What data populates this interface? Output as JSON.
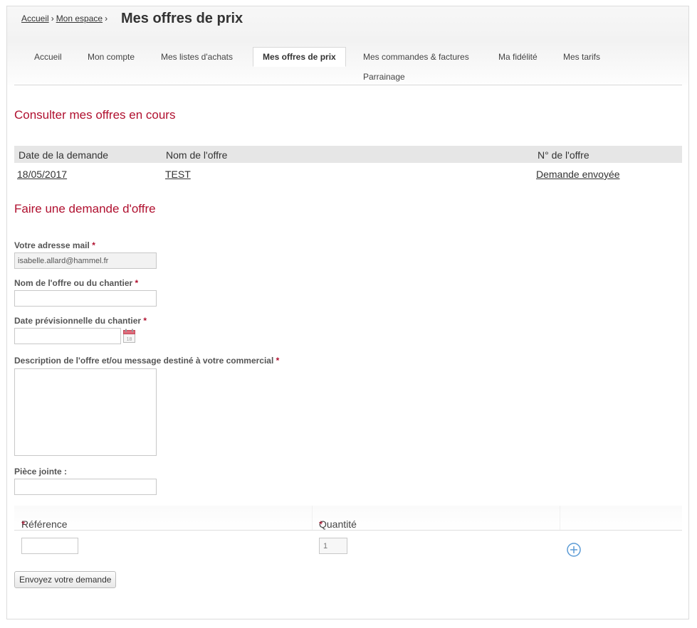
{
  "breadcrumb": {
    "items": [
      "Accueil",
      "Mon espace"
    ],
    "separator": "›"
  },
  "page_title": "Mes offres de prix",
  "tabs": [
    {
      "label": "Accueil"
    },
    {
      "label": "Mon compte"
    },
    {
      "label": "Mes listes d'achats"
    },
    {
      "label": "Mes offres de prix",
      "active": true
    },
    {
      "label": "Mes commandes & factures"
    },
    {
      "label": "Ma fidélité"
    },
    {
      "label": "Mes tarifs"
    },
    {
      "label": "Parrainage"
    }
  ],
  "offers": {
    "title": "Consulter mes offres en cours",
    "columns": [
      "Date de la demande",
      "Nom de l'offre",
      "N° de l'offre"
    ],
    "rows": [
      {
        "date": "18/05/2017",
        "name": "TEST",
        "number": "Demande envoyée"
      }
    ]
  },
  "request_form": {
    "title": "Faire une demande d'offre",
    "required_mark": "*",
    "email_label": "Votre adresse mail",
    "email_value": "isabelle.allard@hammel.fr",
    "offer_name_label": "Nom de l'offre ou du chantier",
    "offer_name_value": "",
    "date_label": "Date prévisionnelle du chantier",
    "date_value": "",
    "calendar_day": "18",
    "description_label": "Description de l'offre et/ou message destiné à votre commercial",
    "description_value": "",
    "attachment_label": "Pièce jointe :",
    "attachment_value": "",
    "items_columns": {
      "reference": "Référence",
      "quantity": "Quantité"
    },
    "reference_value": "",
    "quantity_value": "1",
    "submit_label": "Envoyez votre demande"
  },
  "colors": {
    "accent": "#b0102f",
    "table_header_bg": "#e6e6e6",
    "add_icon": "#5b9bd5"
  }
}
